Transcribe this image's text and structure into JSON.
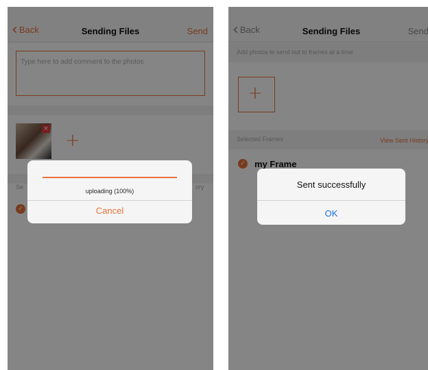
{
  "left_screen": {
    "nav": {
      "back_label": "Back",
      "title": "Sending Files",
      "send_label": "Send"
    },
    "comment": {
      "placeholder": "Type here to add comment to the photos"
    },
    "upload_dialog": {
      "progress": 1.0,
      "progress_text": "uploading (100%)",
      "cancel_label": "Cancel"
    },
    "partial_text": {
      "row_left": "Se",
      "row_right": "ory"
    }
  },
  "right_screen": {
    "nav": {
      "back_label": "Back",
      "title": "Sending Files",
      "send_label": "Send"
    },
    "hint": "Add photos to send out to frames at a time",
    "frames_label": "Selected Frames",
    "view_history_label": "View Sent History",
    "frame_name": "my Frame",
    "success_dialog": {
      "message": "Sent successfully",
      "ok_label": "OK"
    }
  },
  "colors": {
    "accent": "#e8723a",
    "ok_blue": "#1a6fd6",
    "dim_overlay": "rgba(0,0,0,0.48)"
  }
}
